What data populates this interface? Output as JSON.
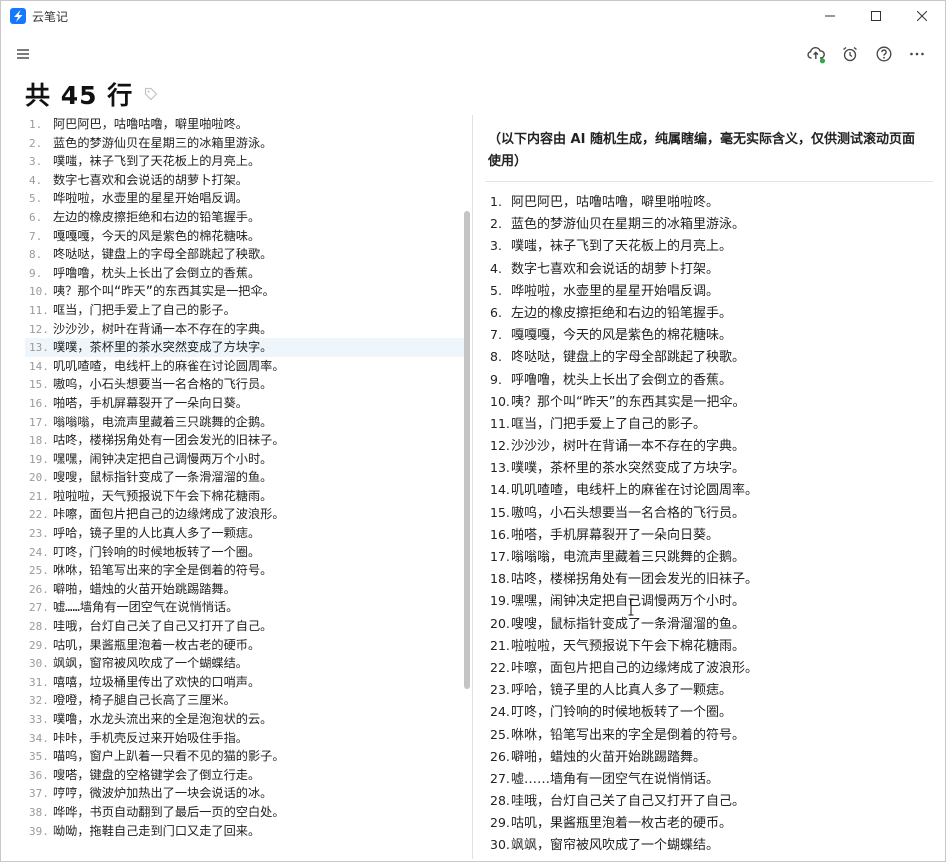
{
  "app": {
    "title": "云笔记",
    "accent": "#1677ff"
  },
  "toolbar": {
    "icons": [
      "menu-icon",
      "cloud-sync-icon",
      "alarm-icon",
      "help-icon",
      "more-icon"
    ],
    "sync_status_color": "#2eaa4b"
  },
  "document": {
    "title": "共 45 行",
    "tag_icon": "tag-icon"
  },
  "editor": {
    "active_line": 13,
    "lines": [
      {
        "n": "1.",
        "t": "阿巴阿巴，咕噜咕噜，噼里啪啦咚。"
      },
      {
        "n": "2.",
        "t": "蓝色的梦游仙贝在星期三的冰箱里游泳。"
      },
      {
        "n": "3.",
        "t": "噗嗤，袜子飞到了天花板上的月亮上。"
      },
      {
        "n": "4.",
        "t": "数字七喜欢和会说话的胡萝卜打架。"
      },
      {
        "n": "5.",
        "t": "哗啦啦，水壶里的星星开始唱反调。"
      },
      {
        "n": "6.",
        "t": "左边的橡皮擦拒绝和右边的铅笔握手。"
      },
      {
        "n": "7.",
        "t": "嘎嘎嘎，今天的风是紫色的棉花糖味。"
      },
      {
        "n": "8.",
        "t": "咚哒哒，键盘上的字母全部跳起了秧歌。"
      },
      {
        "n": "9.",
        "t": "呼噜噜，枕头上长出了会倒立的香蕉。"
      },
      {
        "n": "10.",
        "t": "咦？那个叫“昨天”的东西其实是一把伞。"
      },
      {
        "n": "11.",
        "t": "哐当，门把手爱上了自己的影子。"
      },
      {
        "n": "12.",
        "t": "沙沙沙，树叶在背诵一本不存在的字典。"
      },
      {
        "n": "13.",
        "t": "噗噗，茶杯里的茶水突然变成了方块字。"
      },
      {
        "n": "14.",
        "t": "叽叽喳喳，电线杆上的麻雀在讨论圆周率。"
      },
      {
        "n": "15.",
        "t": "嗷呜，小石头想要当一名合格的飞行员。"
      },
      {
        "n": "16.",
        "t": "啪嗒，手机屏幕裂开了一朵向日葵。"
      },
      {
        "n": "17.",
        "t": "嗡嗡嗡，电流声里藏着三只跳舞的企鹅。"
      },
      {
        "n": "18.",
        "t": "咕咚，楼梯拐角处有一团会发光的旧袜子。"
      },
      {
        "n": "19.",
        "t": "嘿嘿，闹钟决定把自己调慢两万个小时。"
      },
      {
        "n": "20.",
        "t": "嗖嗖，鼠标指针变成了一条滑溜溜的鱼。"
      },
      {
        "n": "21.",
        "t": "啦啦啦，天气预报说下午会下棉花糖雨。"
      },
      {
        "n": "22.",
        "t": "咔嚓，面包片把自己的边缘烤成了波浪形。"
      },
      {
        "n": "23.",
        "t": "呼哈，镜子里的人比真人多了一颗痣。"
      },
      {
        "n": "24.",
        "t": "叮咚，门铃响的时候地板转了一个圈。"
      },
      {
        "n": "25.",
        "t": "咻咻，铅笔写出来的字全是倒着的符号。"
      },
      {
        "n": "26.",
        "t": "噼啪，蜡烛的火苗开始跳踢踏舞。"
      },
      {
        "n": "27.",
        "t": "嘘……墙角有一团空气在说悄悄话。"
      },
      {
        "n": "28.",
        "t": "哇哦，台灯自己关了自己又打开了自己。"
      },
      {
        "n": "29.",
        "t": "咕叽，果酱瓶里泡着一枚古老的硬币。"
      },
      {
        "n": "30.",
        "t": "飒飒，窗帘被风吹成了一个蝴蝶结。"
      },
      {
        "n": "31.",
        "t": "嘻嘻，垃圾桶里传出了欢快的口哨声。"
      },
      {
        "n": "32.",
        "t": "噔噔，椅子腿自己长高了三厘米。"
      },
      {
        "n": "33.",
        "t": "噗噜，水龙头流出来的全是泡泡状的云。"
      },
      {
        "n": "34.",
        "t": "咔咔，手机壳反过来开始吸住手指。"
      },
      {
        "n": "35.",
        "t": "喵呜，窗户上趴着一只看不见的猫的影子。"
      },
      {
        "n": "36.",
        "t": "嗖嗒，键盘的空格键学会了倒立行走。"
      },
      {
        "n": "37.",
        "t": "哼哼，微波炉加热出了一块会说话的冰。"
      },
      {
        "n": "38.",
        "t": "哗哗，书页自动翻到了最后一页的空白处。"
      },
      {
        "n": "39.",
        "t": "呦呦，拖鞋自己走到门口又走了回来。"
      }
    ]
  },
  "preview": {
    "note": "（以下内容由 AI 随机生成，纯属瞎编，毫无实际含义，仅供测试滚动页面使用）",
    "items": [
      {
        "n": "1.",
        "t": "阿巴阿巴，咕噜咕噜，噼里啪啦咚。"
      },
      {
        "n": "2.",
        "t": "蓝色的梦游仙贝在星期三的冰箱里游泳。"
      },
      {
        "n": "3.",
        "t": "噗嗤，袜子飞到了天花板上的月亮上。"
      },
      {
        "n": "4.",
        "t": "数字七喜欢和会说话的胡萝卜打架。"
      },
      {
        "n": "5.",
        "t": "哗啦啦，水壶里的星星开始唱反调。"
      },
      {
        "n": "6.",
        "t": "左边的橡皮擦拒绝和右边的铅笔握手。"
      },
      {
        "n": "7.",
        "t": "嘎嘎嘎，今天的风是紫色的棉花糖味。"
      },
      {
        "n": "8.",
        "t": "咚哒哒，键盘上的字母全部跳起了秧歌。"
      },
      {
        "n": "9.",
        "t": "呼噜噜，枕头上长出了会倒立的香蕉。"
      },
      {
        "n": "10.",
        "t": "咦？那个叫“昨天”的东西其实是一把伞。"
      },
      {
        "n": "11.",
        "t": "哐当，门把手爱上了自己的影子。"
      },
      {
        "n": "12.",
        "t": "沙沙沙，树叶在背诵一本不存在的字典。"
      },
      {
        "n": "13.",
        "t": "噗噗，茶杯里的茶水突然变成了方块字。"
      },
      {
        "n": "14.",
        "t": "叽叽喳喳，电线杆上的麻雀在讨论圆周率。"
      },
      {
        "n": "15.",
        "t": "嗷呜，小石头想要当一名合格的飞行员。"
      },
      {
        "n": "16.",
        "t": "啪嗒，手机屏幕裂开了一朵向日葵。"
      },
      {
        "n": "17.",
        "t": "嗡嗡嗡，电流声里藏着三只跳舞的企鹅。"
      },
      {
        "n": "18.",
        "t": "咕咚，楼梯拐角处有一团会发光的旧袜子。"
      },
      {
        "n": "19.",
        "t": "嘿嘿，闹钟决定把自己调慢两万个小时。"
      },
      {
        "n": "20.",
        "t": "嗖嗖，鼠标指针变成了一条滑溜溜的鱼。"
      },
      {
        "n": "21.",
        "t": "啦啦啦，天气预报说下午会下棉花糖雨。"
      },
      {
        "n": "22.",
        "t": "咔嚓，面包片把自己的边缘烤成了波浪形。"
      },
      {
        "n": "23.",
        "t": "呼哈，镜子里的人比真人多了一颗痣。"
      },
      {
        "n": "24.",
        "t": "叮咚，门铃响的时候地板转了一个圈。"
      },
      {
        "n": "25.",
        "t": "咻咻，铅笔写出来的字全是倒着的符号。"
      },
      {
        "n": "26.",
        "t": "噼啪，蜡烛的火苗开始跳踢踏舞。"
      },
      {
        "n": "27.",
        "t": "嘘……墙角有一团空气在说悄悄话。"
      },
      {
        "n": "28.",
        "t": "哇哦，台灯自己关了自己又打开了自己。"
      },
      {
        "n": "29.",
        "t": "咕叽，果酱瓶里泡着一枚古老的硬币。"
      },
      {
        "n": "30.",
        "t": "飒飒，窗帘被风吹成了一个蝴蝶结。"
      }
    ]
  }
}
